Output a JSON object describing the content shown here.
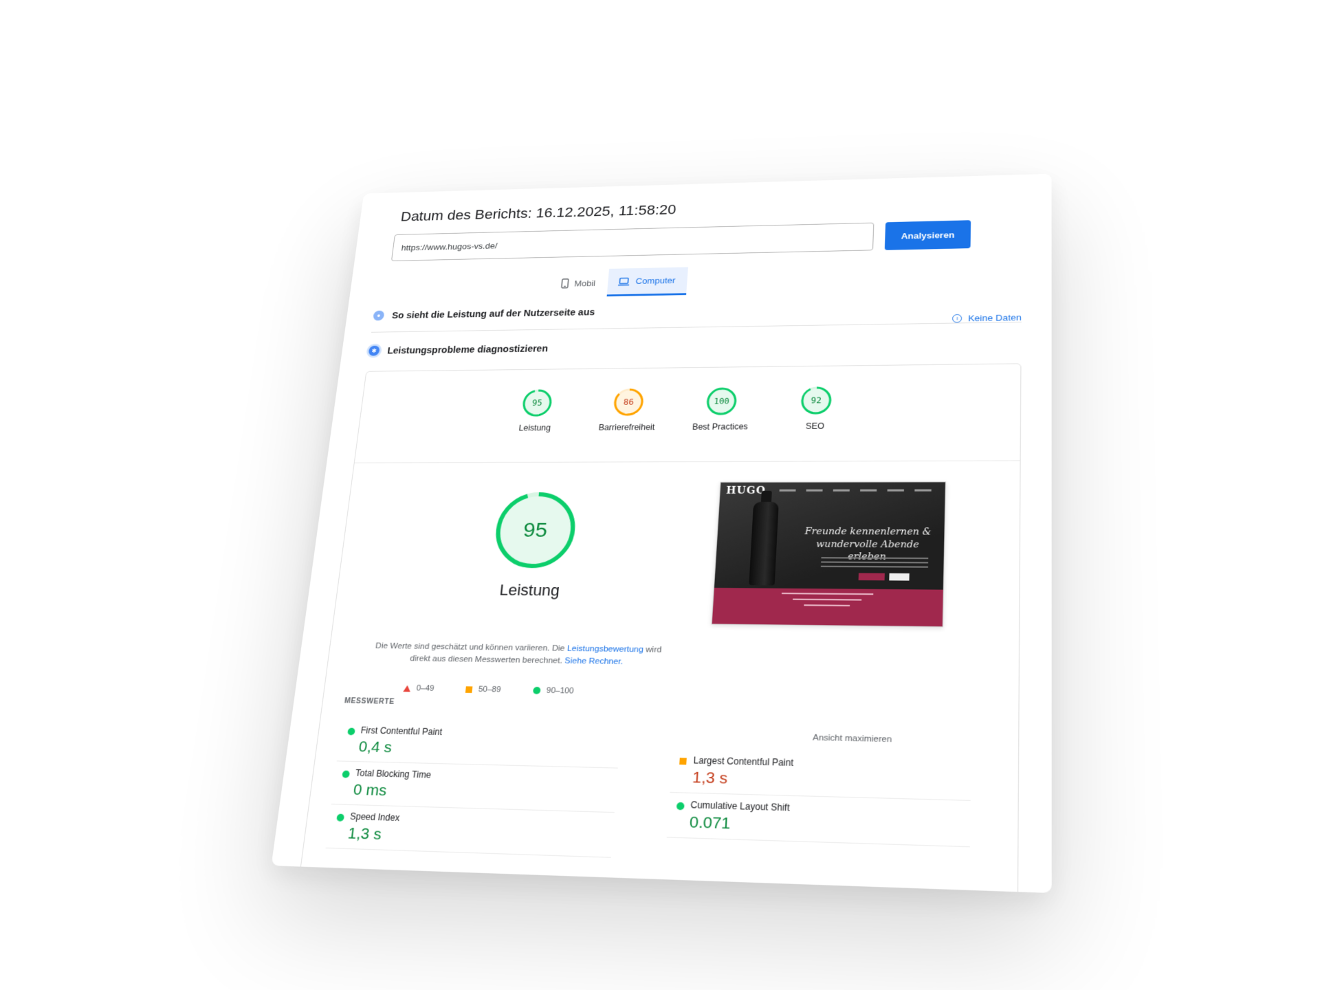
{
  "header": {
    "title": "Datum des Berichts: 16.12.2025, 11:58:20"
  },
  "url_bar": {
    "value": "https://www.hugos-vs.de/",
    "analyze_label": "Analysieren"
  },
  "device_tabs": {
    "mobile_label": "Mobil",
    "computer_label": "Computer",
    "selected": "Computer"
  },
  "sections": {
    "user_experience": "So sieht die Leistung auf der Nutzerseite aus",
    "no_data_link": "Keine Daten",
    "diagnose": "Leistungsprobleme diagnostizieren"
  },
  "scores": [
    {
      "label": "Leistung",
      "value": 95,
      "color": "#0cce6b"
    },
    {
      "label": "Barrierefreiheit",
      "value": 86,
      "color": "#ffa400"
    },
    {
      "label": "Best Practices",
      "value": 100,
      "color": "#0cce6b"
    },
    {
      "label": "SEO",
      "value": 92,
      "color": "#0cce6b"
    }
  ],
  "performance": {
    "score": 95,
    "label": "Leistung",
    "note_text": "Die Werte sind geschätzt und können variieren. Die",
    "note_link1": "Leistungsbewertung",
    "note_text2": "wird direkt aus diesen Messwerten berechnet.",
    "note_link2": "Siehe Rechner.",
    "legend": [
      {
        "range": "0–49",
        "shape": "triangle",
        "color": "#e8453c"
      },
      {
        "range": "50–89",
        "shape": "square",
        "color": "#ffa400"
      },
      {
        "range": "90–100",
        "shape": "circle",
        "color": "#0cce6b"
      }
    ]
  },
  "preview": {
    "logo": "HUGO",
    "headline": "Freunde kennenlernen & wundervolle Abende erleben",
    "maximize_label": "Ansicht maximieren"
  },
  "metrics": {
    "section_label": "MESSWERTE",
    "fcp": {
      "name": "First Contentful Paint",
      "value": "0,4 s",
      "status": "good"
    },
    "tbt": {
      "name": "Total Blocking Time",
      "value": "0 ms",
      "status": "good"
    },
    "si": {
      "name": "Speed Index",
      "value": "1,3 s",
      "status": "good"
    },
    "lcp": {
      "name": "Largest Contentful Paint",
      "value": "1,3 s",
      "status": "average"
    },
    "cls": {
      "name": "Cumulative Layout Shift",
      "value": "0.071",
      "status": "good"
    }
  },
  "colors": {
    "accent": "#1a73e8",
    "good": "#0cce6b",
    "average": "#ffa400",
    "poor": "#e8453c"
  }
}
